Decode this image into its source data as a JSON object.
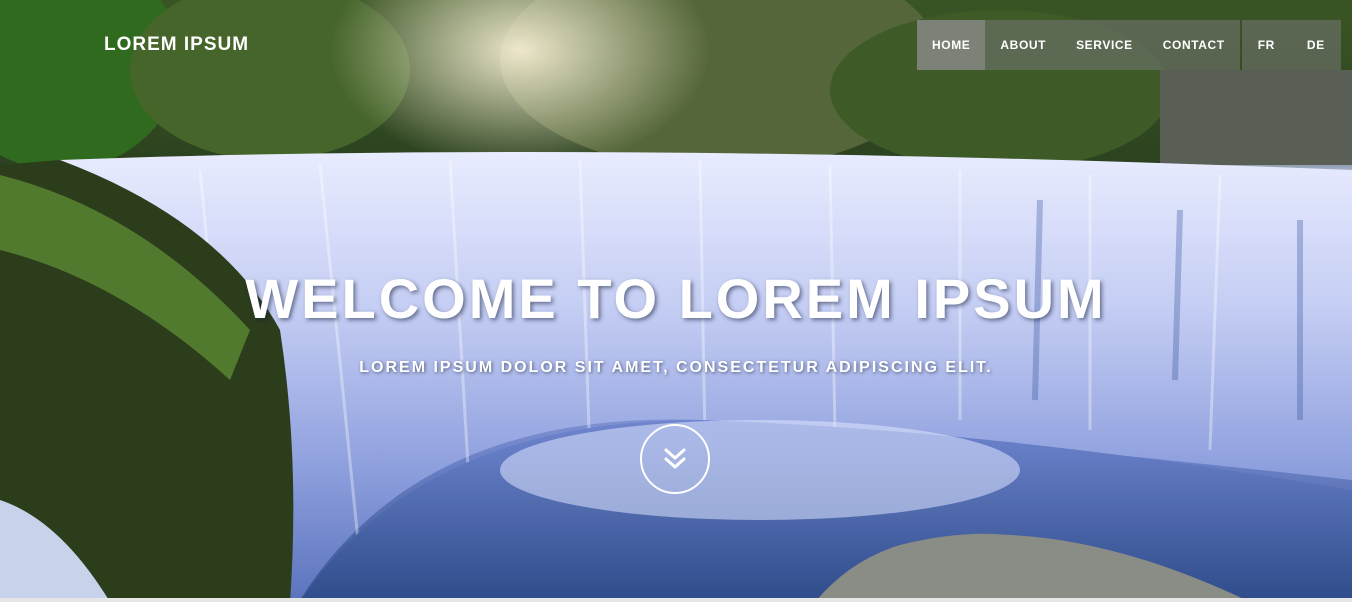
{
  "brand": {
    "name": "LOREM IPSUM"
  },
  "nav": {
    "items": [
      {
        "label": "HOME",
        "active": true
      },
      {
        "label": "ABOUT",
        "active": false
      },
      {
        "label": "SERVICE",
        "active": false
      },
      {
        "label": "CONTACT",
        "active": false
      }
    ],
    "languages": [
      {
        "label": "FR"
      },
      {
        "label": "DE"
      }
    ]
  },
  "hero": {
    "headline": "WELCOME TO LOREM IPSUM",
    "subheadline": "LOREM IPSUM DOLOR SIT AMET, CONSECTETUR ADIPISCING ELIT.",
    "scroll_icon": "double-chevron-down-icon",
    "background": "waterfall-photo"
  },
  "colors": {
    "text": "#ffffff",
    "nav_background": "#787878",
    "nav_active": "#969696"
  }
}
